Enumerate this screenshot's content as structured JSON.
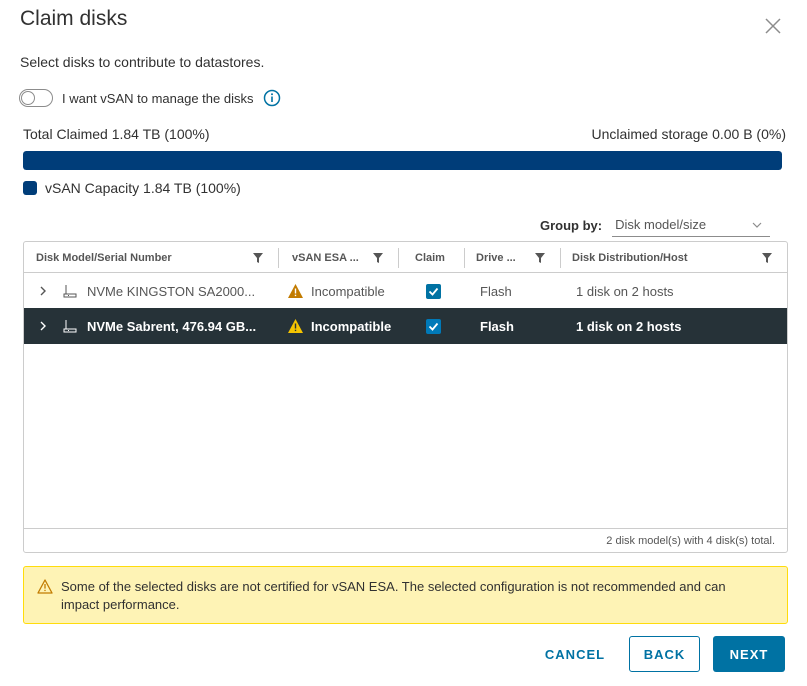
{
  "dialog": {
    "title": "Claim disks",
    "subtitle": "Select disks to contribute to datastores."
  },
  "vsan_toggle": {
    "label": "I want vSAN to manage the disks",
    "checked": false
  },
  "capacity": {
    "claimed_label": "Total Claimed 1.84 TB (100%)",
    "unclaimed_label": "Unclaimed storage 0.00 B (0%)",
    "claimed_fraction": 1.0,
    "bar_color": "#003d79",
    "legend_label": "vSAN Capacity 1.84 TB (100%)"
  },
  "group_by": {
    "label": "Group by:",
    "selected": "Disk model/size"
  },
  "grid": {
    "columns": [
      {
        "label": "Disk Model/Serial Number"
      },
      {
        "label": "vSAN ESA ..."
      },
      {
        "label": "Claim"
      },
      {
        "label": "Drive ..."
      },
      {
        "label": "Disk Distribution/Host"
      }
    ],
    "rows": [
      {
        "model": "NVMe KINGSTON SA2000...",
        "esa": "Incompatible",
        "claimed": true,
        "drive": "Flash",
        "distribution": "1 disk on 2 hosts",
        "selected": false
      },
      {
        "model": "NVMe Sabrent, 476.94 GB...",
        "esa": "Incompatible",
        "claimed": true,
        "drive": "Flash",
        "distribution": "1 disk on 2 hosts",
        "selected": true
      }
    ],
    "footer": "2 disk model(s) with 4 disk(s) total."
  },
  "alert": {
    "text": "Some of the selected disks are not certified for vSAN ESA. The selected configuration is not recommended and can impact performance.",
    "color": "#fef3b5"
  },
  "buttons": {
    "cancel": "CANCEL",
    "back": "BACK",
    "next": "NEXT"
  },
  "colors": {
    "primary": "#0072a3",
    "selected_row": "#263238",
    "warning": "#c27b00"
  }
}
